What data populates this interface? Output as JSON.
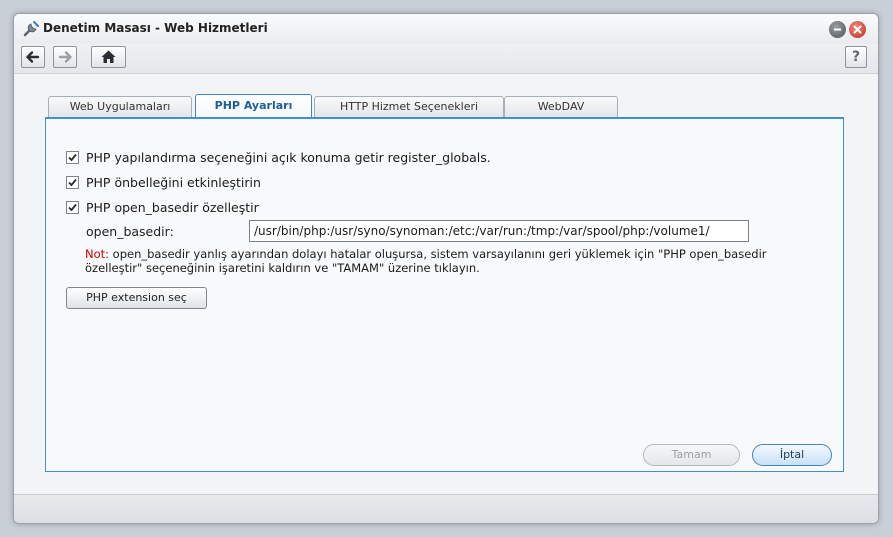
{
  "window": {
    "title": "Denetim Masası - Web Hizmetleri",
    "icon": "wrench-icon"
  },
  "toolbar": {
    "back_icon": "arrow-left-icon",
    "forward_icon": "arrow-right-icon",
    "home_icon": "home-icon",
    "help_label": "?"
  },
  "tabs": [
    {
      "label": "Web Uygulamaları",
      "active": false
    },
    {
      "label": "PHP Ayarları",
      "active": true
    },
    {
      "label": "HTTP Hizmet Seçenekleri",
      "active": false
    },
    {
      "label": "WebDAV",
      "active": false
    }
  ],
  "settings": {
    "register_globals": {
      "label": "PHP yapılandırma seçeneğini açık konuma getir register_globals.",
      "checked": true
    },
    "cache": {
      "label": "PHP önbelleğini etkinleştirin",
      "checked": true
    },
    "open_basedir_custom": {
      "label": "PHP open_basedir özelleştir",
      "checked": true
    },
    "open_basedir_label": "open_basedir:",
    "open_basedir_value": "/usr/bin/php:/usr/syno/synoman:/etc:/var/run:/tmp:/var/spool/php:/volume1/",
    "note_prefix": "Not:",
    "note_text": " open_basedir yanlış ayarından dolayı hatalar oluşursa, sistem varsayılanını geri yüklemek için \"PHP open_basedir özelleştir\" seçeneğinin işaretini kaldırın ve \"TAMAM\" üzerine tıklayın.",
    "extension_button": "PHP extension seç"
  },
  "buttons": {
    "ok": "Tamam",
    "cancel": "İptal"
  },
  "colors": {
    "accent": "#3f8fd2",
    "note_prefix": "#d40000"
  }
}
